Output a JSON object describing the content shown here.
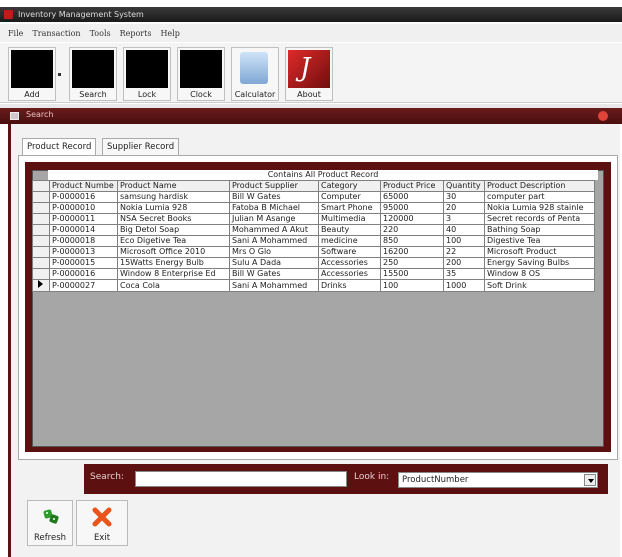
{
  "window": {
    "title": "Inventory Management System"
  },
  "menu": [
    "File",
    "Transaction",
    "Tools",
    "Reports",
    "Help"
  ],
  "toolbar": {
    "add": "Add",
    "search": "Search",
    "lock": "Lock",
    "clock": "Clock",
    "calculator": "Calculator",
    "about": "About"
  },
  "search_window": {
    "title": "Search"
  },
  "tabs": [
    "Product Record",
    "Supplier Record"
  ],
  "grid": {
    "caption": "Contains All Product Record",
    "columns": [
      "Product Numbe",
      "Product Name",
      "Product Supplier",
      "Category",
      "Product Price",
      "Quantity",
      "Product Description"
    ],
    "rows": [
      [
        "P-0000016",
        "samsung hardisk",
        "Bill W Gates",
        "Computer",
        "65000",
        "30",
        "computer part"
      ],
      [
        "P-0000010",
        "Nokia Lumia 928",
        "Fatoba B Michael",
        "Smart Phone",
        "95000",
        "20",
        "Nokia Lumia 928 stainle"
      ],
      [
        "P-0000011",
        "NSA Secret Books",
        "Julian M Asange",
        "Multimedia",
        "120000",
        "3",
        "Secret records of Penta"
      ],
      [
        "P-0000014",
        "Big Detol Soap",
        "Mohammed A Akut",
        "Beauty",
        "220",
        "40",
        "Bathing Soap"
      ],
      [
        "P-0000018",
        "Eco Digetive Tea",
        "Sani A Mohammed",
        "medicine",
        "850",
        "100",
        "Digestive Tea"
      ],
      [
        "P-0000013",
        "Microsoft Office 2010",
        "Mrs O Glo",
        "Software",
        "16200",
        "22",
        "Microsoft Product"
      ],
      [
        "P-0000015",
        "15Watts Energy Bulb",
        "Sulu A Dada",
        "Accessories",
        "250",
        "200",
        "Energy Saving Bulbs"
      ],
      [
        "P-0000016",
        "Window 8 Enterprise Ed",
        "Bill W Gates",
        "Accessories",
        "15500",
        "35",
        "Window 8 OS"
      ],
      [
        "P-0000027",
        "Coca Cola",
        "Sani A Mohammed",
        "Drinks",
        "100",
        "1000",
        "Soft Drink"
      ]
    ]
  },
  "search": {
    "label": "Search:",
    "value": "",
    "lookin_label": "Look in:",
    "lookin_value": "ProductNumber"
  },
  "bottom": {
    "refresh": "Refresh",
    "exit": "Exit"
  },
  "colors": {
    "frame": "#5d1010",
    "accent": "#c01a1a"
  }
}
